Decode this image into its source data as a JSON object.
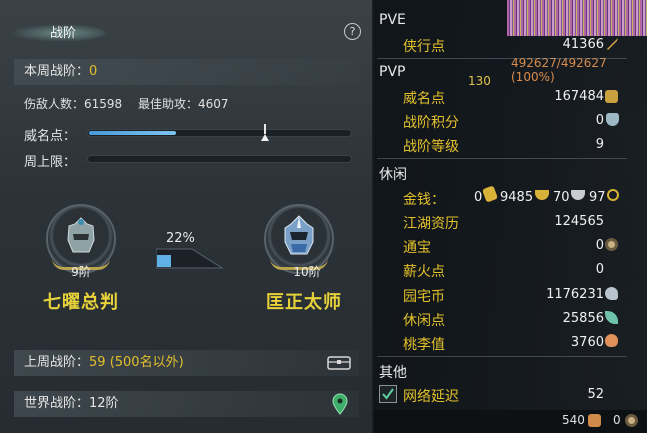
{
  "left_panel": {
    "title": "战阶",
    "help": "?",
    "weekly_rank_label": "本周战阶：",
    "weekly_rank_value": "0",
    "stats": "伤敌人数：61598　 最佳助攻：4607",
    "prestige_label": "威名点：",
    "weekly_cap_label": "周上限：",
    "prestige_progress": 0.33,
    "prestige_marker": 0.67,
    "current_rank": {
      "level": "9阶",
      "name": "七曜总判"
    },
    "next_rank": {
      "level": "10阶",
      "name": "匡正太师"
    },
    "progress_percent": "22%",
    "progress_value": 0.22,
    "last_week_label": "上周战阶：",
    "last_week_value": "59 (500名以外)",
    "world_rank_label": "世界战阶：",
    "world_rank_value": "12阶"
  },
  "right_panel": {
    "pve_header": "PVE",
    "pve_items": [
      {
        "label": "侠行点",
        "value": "41366",
        "icon": "sword-icon"
      }
    ],
    "pvp_header": "PVP",
    "pvp_items": [
      {
        "label": "威名点",
        "value": "167484",
        "icon": "badge-icon"
      },
      {
        "label": "战阶积分",
        "value": "0",
        "icon": "shield-icon"
      },
      {
        "label": "战阶等级",
        "value": "9",
        "icon": ""
      }
    ],
    "leisure_header": "休闲",
    "money": {
      "label": "金钱：",
      "v1": "0",
      "v2": "9485",
      "v3": "70",
      "v4": "97"
    },
    "leisure_items": [
      {
        "label": "江湖资历",
        "value": "124565",
        "icon": ""
      },
      {
        "label": "通宝",
        "value": "0",
        "icon": "coin-icon"
      },
      {
        "label": "薪火点",
        "value": "0",
        "icon": ""
      },
      {
        "label": "园宅币",
        "value": "1176231",
        "icon": "house-coin-icon"
      },
      {
        "label": "休闲点",
        "value": "25856",
        "icon": "leaf-icon"
      },
      {
        "label": "桃李值",
        "value": "3760",
        "icon": "peach-icon"
      }
    ],
    "other_header": "其他",
    "network_label": "网络延迟",
    "network_value": "52",
    "hp_text": "492627/492627 (100%)",
    "level_text": "130",
    "bottom_value1": "540",
    "bottom_value2": "0"
  }
}
